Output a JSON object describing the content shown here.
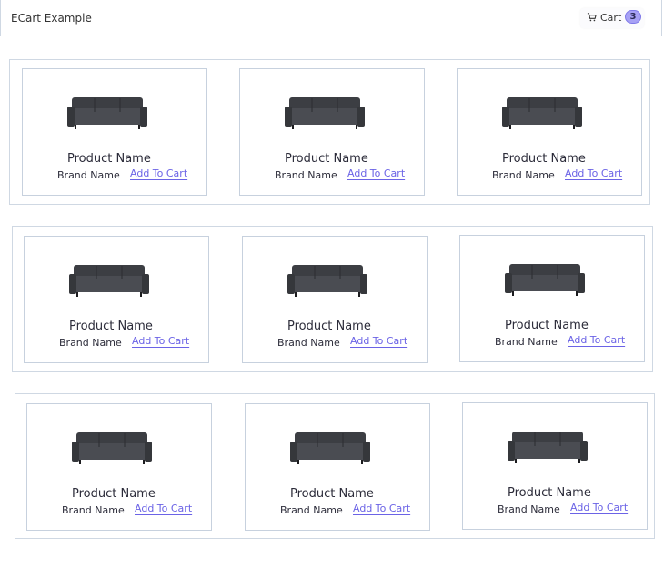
{
  "app": {
    "title": "ECart Example"
  },
  "cart": {
    "label": "Cart",
    "count": "3",
    "badge_color": "#a7a1f5",
    "icon": "cart-icon"
  },
  "rows": [
    {
      "products": [
        {
          "name": "Product Name",
          "brand": "Brand Name",
          "action": "Add To Cart",
          "image": "sofa-image"
        },
        {
          "name": "Product Name",
          "brand": "Brand Name",
          "action": "Add To Cart",
          "image": "sofa-image"
        },
        {
          "name": "Product Name",
          "brand": "Brand Name",
          "action": "Add To Cart",
          "image": "sofa-image"
        }
      ]
    },
    {
      "products": [
        {
          "name": "Product Name",
          "brand": "Brand Name",
          "action": "Add To Cart",
          "image": "sofa-image"
        },
        {
          "name": "Product Name",
          "brand": "Brand Name",
          "action": "Add To Cart",
          "image": "sofa-image"
        },
        {
          "name": "Product Name",
          "brand": "Brand Name",
          "action": "Add To Cart",
          "image": "sofa-image"
        }
      ]
    },
    {
      "products": [
        {
          "name": "Product Name",
          "brand": "Brand Name",
          "action": "Add To Cart",
          "image": "sofa-image"
        },
        {
          "name": "Product Name",
          "brand": "Brand Name",
          "action": "Add To Cart",
          "image": "sofa-image"
        },
        {
          "name": "Product Name",
          "brand": "Brand Name",
          "action": "Add To Cart",
          "image": "sofa-image"
        }
      ]
    }
  ],
  "colors": {
    "accent": "#6b63e6",
    "border": "#cfd8e3"
  }
}
